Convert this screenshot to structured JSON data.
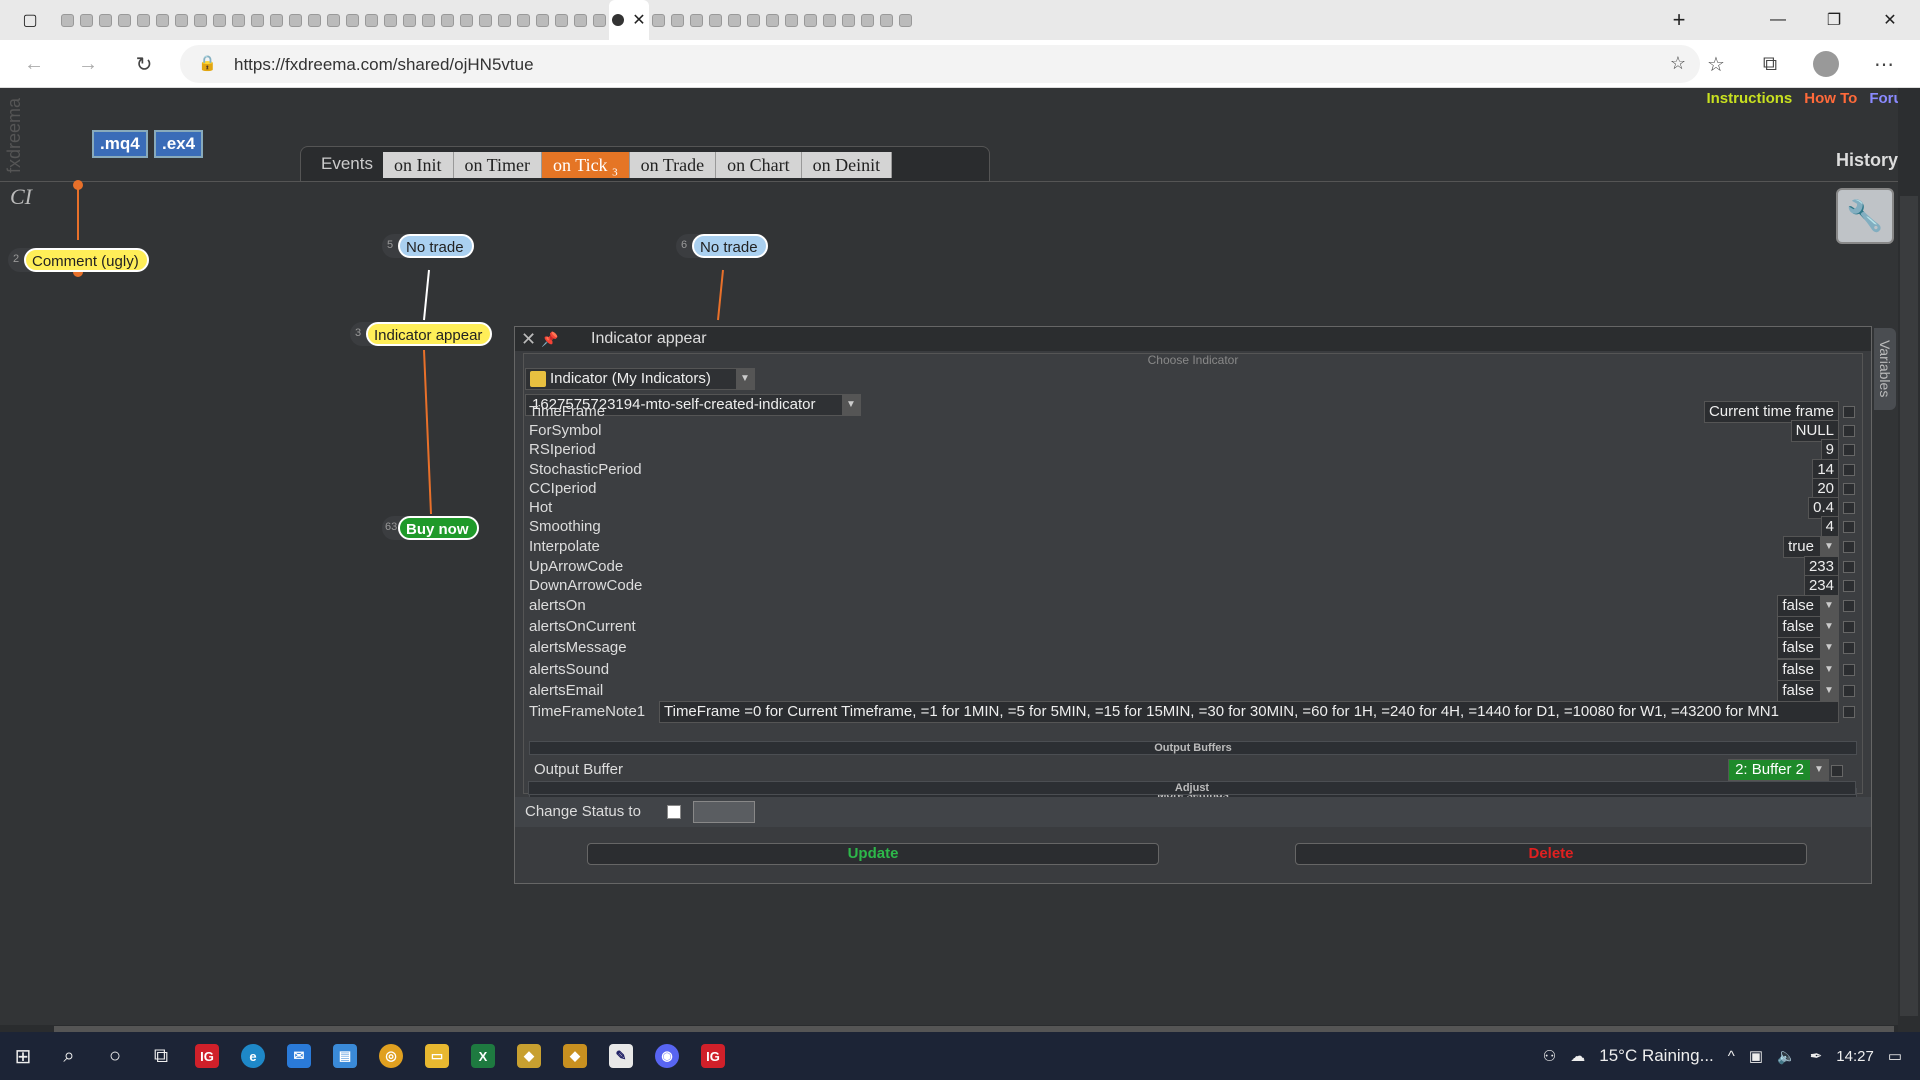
{
  "browser": {
    "url": "https://fxdreema.com/shared/ojHN5vtue",
    "tab_count": 44,
    "active_tab_index": 29
  },
  "toplinks": {
    "instructions": "Instructions",
    "how_to": "How To",
    "forum": "Forum",
    "colors": {
      "instructions": "#c8e020",
      "how_to": "#ff6a3a",
      "forum": "#8a8aff"
    }
  },
  "brand": "fxdreema",
  "export_buttons": {
    "mq4": ".mq4",
    "ex4": ".ex4"
  },
  "events": {
    "label": "Events",
    "tabs": [
      {
        "label": "on Init",
        "badge": ""
      },
      {
        "label": "on Timer",
        "badge": ""
      },
      {
        "label": "on Tick",
        "badge": "3"
      },
      {
        "label": "on Trade",
        "badge": ""
      },
      {
        "label": "on Chart",
        "badge": ""
      },
      {
        "label": "on Deinit",
        "badge": ""
      }
    ],
    "active": "on Tick"
  },
  "history": "History",
  "ci_label": "CI",
  "nodes": {
    "comment": {
      "num": "2",
      "label": "Comment (ugly)"
    },
    "no_trade_1": {
      "num": "5",
      "label": "No trade"
    },
    "no_trade_2": {
      "num": "6",
      "label": "No trade"
    },
    "indicator_appear": {
      "num": "3",
      "label": "Indicator appear"
    },
    "buy_now": {
      "num": "63",
      "label": "Buy now"
    }
  },
  "dialog": {
    "title": "Indicator appear",
    "choose_indicator": "Choose Indicator",
    "indicator_type": "Indicator (My Indicators)",
    "indicator_name": "1627575723194-mto-self-created-indicator",
    "params": [
      {
        "name": "TimeFrame",
        "value": "Current time frame",
        "dropdown": false
      },
      {
        "name": "ForSymbol",
        "value": "NULL",
        "dropdown": false
      },
      {
        "name": "RSIperiod",
        "value": "9",
        "dropdown": false
      },
      {
        "name": "StochasticPeriod",
        "value": "14",
        "dropdown": false
      },
      {
        "name": "CCIperiod",
        "value": "20",
        "dropdown": false
      },
      {
        "name": "Hot",
        "value": "0.4",
        "dropdown": false
      },
      {
        "name": "Smoothing",
        "value": "4",
        "dropdown": false
      },
      {
        "name": "Interpolate",
        "value": "true",
        "dropdown": true
      },
      {
        "name": "UpArrowCode",
        "value": "233",
        "dropdown": false
      },
      {
        "name": "DownArrowCode",
        "value": "234",
        "dropdown": false
      },
      {
        "name": "alertsOn",
        "value": "false",
        "dropdown": true
      },
      {
        "name": "alertsOnCurrent",
        "value": "false",
        "dropdown": true
      },
      {
        "name": "alertsMessage",
        "value": "false",
        "dropdown": true
      },
      {
        "name": "alertsSound",
        "value": "false",
        "dropdown": true
      },
      {
        "name": "alertsEmail",
        "value": "false",
        "dropdown": true
      },
      {
        "name": "TimeFrameNote1",
        "value": "TimeFrame =0 for Current Timeframe, =1 for 1MIN, =5 for 5MIN, =15 for 15MIN, =30 for 30MIN, =60 for 1H, =240 for 4H, =1440 for D1, =10080 for W1, =43200 for MN1",
        "dropdown": false
      }
    ],
    "output_buffers_label": "Output Buffers",
    "output_buffer_name": "Output Buffer",
    "output_buffer_value": "2: Buffer 2",
    "more_settings": "More settings",
    "adjust": "Adjust",
    "change_status": "Change Status to",
    "update": "Update",
    "delete": "Delete",
    "variables_tab": "Variables"
  },
  "taskbar": {
    "weather": "15°C Raining...",
    "time": "14:27"
  }
}
